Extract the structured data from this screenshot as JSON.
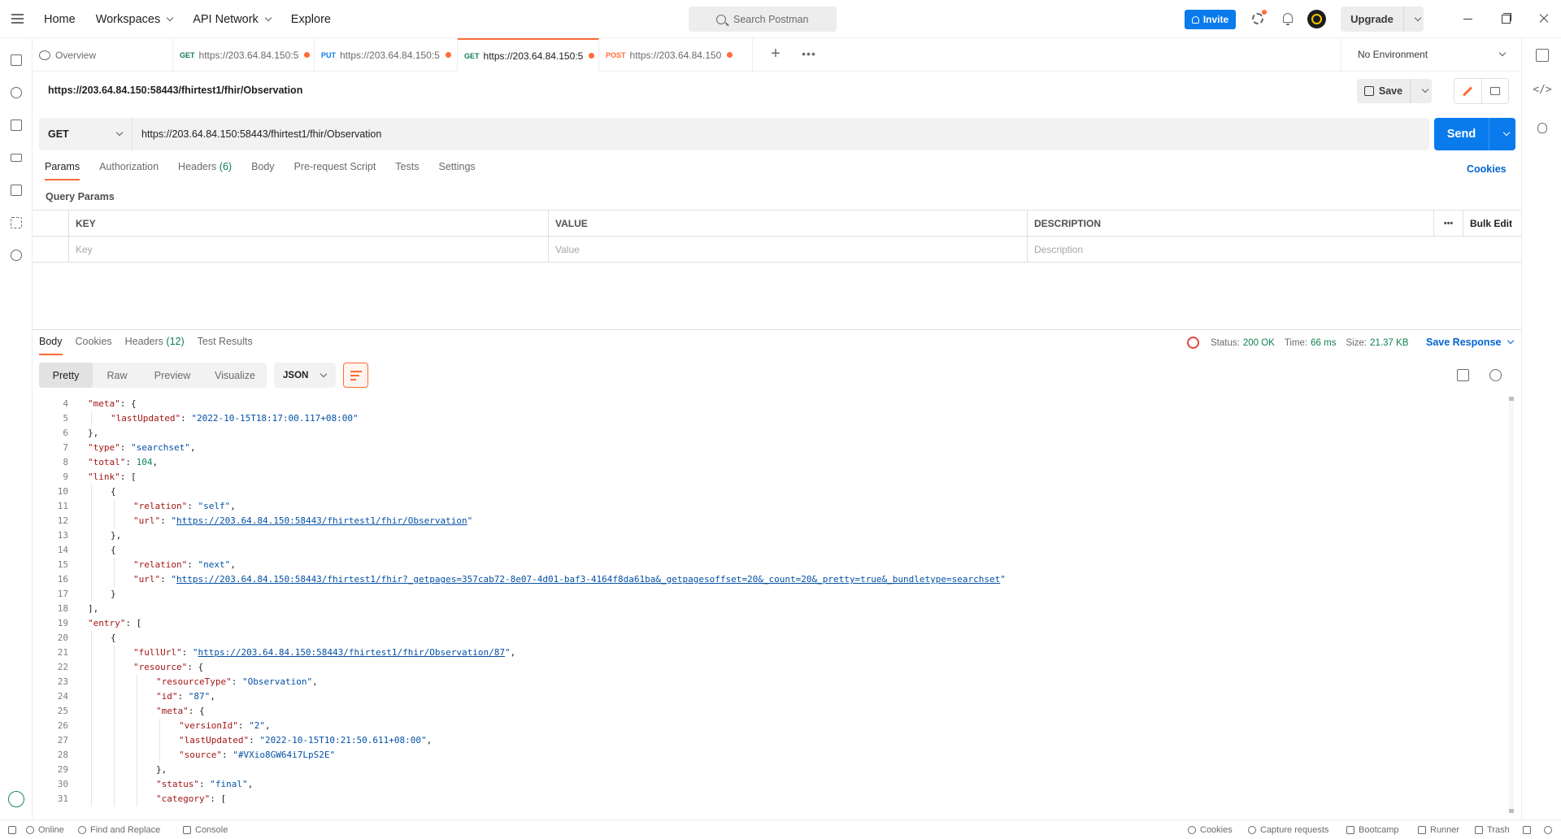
{
  "nav": {
    "home": "Home",
    "workspaces": "Workspaces",
    "api_network": "API Network",
    "explore": "Explore",
    "search_placeholder": "Search Postman",
    "invite": "Invite",
    "upgrade": "Upgrade"
  },
  "tabs": [
    {
      "method": "",
      "label": "Overview",
      "unsaved": false
    },
    {
      "method": "GET",
      "label": "https://203.64.84.150:5",
      "unsaved": true,
      "method_color": "#0c7f4e"
    },
    {
      "method": "PUT",
      "label": "https://203.64.84.150:5",
      "unsaved": true,
      "method_color": "#097bed"
    },
    {
      "method": "GET",
      "label": "https://203.64.84.150:5",
      "unsaved": true,
      "method_color": "#0c7f4e",
      "active": true
    },
    {
      "method": "POST",
      "label": "https://203.64.84.150",
      "unsaved": true,
      "method_color": "#ff6c37"
    }
  ],
  "environment": "No Environment",
  "request": {
    "title": "https://203.64.84.150:58443/fhirtest1/fhir/Observation",
    "save_label": "Save",
    "method": "GET",
    "url": "https://203.64.84.150:58443/fhirtest1/fhir/Observation",
    "send_label": "Send",
    "subtabs": [
      {
        "label": "Params",
        "count": "",
        "active": true
      },
      {
        "label": "Authorization",
        "count": ""
      },
      {
        "label": "Headers",
        "count": "(6)"
      },
      {
        "label": "Body",
        "count": ""
      },
      {
        "label": "Pre-request Script",
        "count": ""
      },
      {
        "label": "Tests",
        "count": ""
      },
      {
        "label": "Settings",
        "count": ""
      }
    ],
    "cookies_link": "Cookies",
    "query_params_title": "Query Params",
    "params_table": {
      "headers": {
        "key": "KEY",
        "value": "VALUE",
        "description": "DESCRIPTION",
        "more": "•••",
        "bulk_edit": "Bulk Edit"
      },
      "placeholders": {
        "key": "Key",
        "value": "Value",
        "description": "Description"
      }
    }
  },
  "response": {
    "tabs": [
      {
        "label": "Body",
        "count": "",
        "active": true
      },
      {
        "label": "Cookies",
        "count": ""
      },
      {
        "label": "Headers",
        "count": "(12)"
      },
      {
        "label": "Test Results",
        "count": ""
      }
    ],
    "status_label": "Status:",
    "status_value": "200 OK",
    "time_label": "Time:",
    "time_value": "66 ms",
    "size_label": "Size:",
    "size_value": "21.37 KB",
    "save_response": "Save Response",
    "views": [
      "Pretty",
      "Raw",
      "Preview",
      "Visualize"
    ],
    "format": "JSON",
    "code_lines": [
      {
        "n": "4",
        "indent": 1,
        "parts": [
          [
            "k",
            "\"meta\""
          ],
          [
            "p",
            ": {"
          ]
        ]
      },
      {
        "n": "5",
        "indent": 2,
        "parts": [
          [
            "k",
            "\"lastUpdated\""
          ],
          [
            "p",
            ": "
          ],
          [
            "s",
            "\"2022-10-15T18:17:00.117+08:00\""
          ]
        ]
      },
      {
        "n": "6",
        "indent": 1,
        "parts": [
          [
            "p",
            "},"
          ]
        ]
      },
      {
        "n": "7",
        "indent": 1,
        "parts": [
          [
            "k",
            "\"type\""
          ],
          [
            "p",
            ": "
          ],
          [
            "s",
            "\"searchset\""
          ],
          [
            "p",
            ","
          ]
        ]
      },
      {
        "n": "8",
        "indent": 1,
        "parts": [
          [
            "k",
            "\"total\""
          ],
          [
            "p",
            ": "
          ],
          [
            "nm",
            "104"
          ],
          [
            "p",
            ","
          ]
        ]
      },
      {
        "n": "9",
        "indent": 1,
        "parts": [
          [
            "k",
            "\"link\""
          ],
          [
            "p",
            ": ["
          ]
        ]
      },
      {
        "n": "10",
        "indent": 2,
        "parts": [
          [
            "p",
            "{"
          ]
        ]
      },
      {
        "n": "11",
        "indent": 3,
        "parts": [
          [
            "k",
            "\"relation\""
          ],
          [
            "p",
            ": "
          ],
          [
            "s",
            "\"self\""
          ],
          [
            "p",
            ","
          ]
        ]
      },
      {
        "n": "12",
        "indent": 3,
        "parts": [
          [
            "k",
            "\"url\""
          ],
          [
            "p",
            ": "
          ],
          [
            "s",
            "\""
          ],
          [
            "u",
            "https://203.64.84.150:58443/fhirtest1/fhir/Observation"
          ],
          [
            "s",
            "\""
          ]
        ]
      },
      {
        "n": "13",
        "indent": 2,
        "parts": [
          [
            "p",
            "},"
          ]
        ]
      },
      {
        "n": "14",
        "indent": 2,
        "parts": [
          [
            "p",
            "{"
          ]
        ]
      },
      {
        "n": "15",
        "indent": 3,
        "parts": [
          [
            "k",
            "\"relation\""
          ],
          [
            "p",
            ": "
          ],
          [
            "s",
            "\"next\""
          ],
          [
            "p",
            ","
          ]
        ]
      },
      {
        "n": "16",
        "indent": 3,
        "parts": [
          [
            "k",
            "\"url\""
          ],
          [
            "p",
            ": "
          ],
          [
            "s",
            "\""
          ],
          [
            "u",
            "https://203.64.84.150:58443/fhirtest1/fhir?_getpages=357cab72-8e07-4d01-baf3-4164f8da61ba&_getpagesoffset=20&_count=20&_pretty=true&_bundletype=searchset"
          ],
          [
            "s",
            "\""
          ]
        ]
      },
      {
        "n": "17",
        "indent": 2,
        "parts": [
          [
            "p",
            "}"
          ]
        ]
      },
      {
        "n": "18",
        "indent": 1,
        "parts": [
          [
            "p",
            "],"
          ]
        ]
      },
      {
        "n": "19",
        "indent": 1,
        "parts": [
          [
            "k",
            "\"entry\""
          ],
          [
            "p",
            ": ["
          ]
        ]
      },
      {
        "n": "20",
        "indent": 2,
        "parts": [
          [
            "p",
            "{"
          ]
        ]
      },
      {
        "n": "21",
        "indent": 3,
        "parts": [
          [
            "k",
            "\"fullUrl\""
          ],
          [
            "p",
            ": "
          ],
          [
            "s",
            "\""
          ],
          [
            "u",
            "https://203.64.84.150:58443/fhirtest1/fhir/Observation/87"
          ],
          [
            "s",
            "\""
          ],
          [
            "p",
            ","
          ]
        ]
      },
      {
        "n": "22",
        "indent": 3,
        "parts": [
          [
            "k",
            "\"resource\""
          ],
          [
            "p",
            ": {"
          ]
        ]
      },
      {
        "n": "23",
        "indent": 4,
        "parts": [
          [
            "k",
            "\"resourceType\""
          ],
          [
            "p",
            ": "
          ],
          [
            "s",
            "\"Observation\""
          ],
          [
            "p",
            ","
          ]
        ]
      },
      {
        "n": "24",
        "indent": 4,
        "parts": [
          [
            "k",
            "\"id\""
          ],
          [
            "p",
            ": "
          ],
          [
            "s",
            "\"87\""
          ],
          [
            "p",
            ","
          ]
        ]
      },
      {
        "n": "25",
        "indent": 4,
        "parts": [
          [
            "k",
            "\"meta\""
          ],
          [
            "p",
            ": {"
          ]
        ]
      },
      {
        "n": "26",
        "indent": 5,
        "parts": [
          [
            "k",
            "\"versionId\""
          ],
          [
            "p",
            ": "
          ],
          [
            "s",
            "\"2\""
          ],
          [
            "p",
            ","
          ]
        ]
      },
      {
        "n": "27",
        "indent": 5,
        "parts": [
          [
            "k",
            "\"lastUpdated\""
          ],
          [
            "p",
            ": "
          ],
          [
            "s",
            "\"2022-10-15T10:21:50.611+08:00\""
          ],
          [
            "p",
            ","
          ]
        ]
      },
      {
        "n": "28",
        "indent": 5,
        "parts": [
          [
            "k",
            "\"source\""
          ],
          [
            "p",
            ": "
          ],
          [
            "s",
            "\"#VXio8GW64i7LpS2E\""
          ]
        ]
      },
      {
        "n": "29",
        "indent": 4,
        "parts": [
          [
            "p",
            "},"
          ]
        ]
      },
      {
        "n": "30",
        "indent": 4,
        "parts": [
          [
            "k",
            "\"status\""
          ],
          [
            "p",
            ": "
          ],
          [
            "s",
            "\"final\""
          ],
          [
            "p",
            ","
          ]
        ]
      },
      {
        "n": "31",
        "indent": 4,
        "parts": [
          [
            "k",
            "\"category\""
          ],
          [
            "p",
            ": ["
          ]
        ]
      }
    ]
  },
  "statusbar": {
    "online": "Online",
    "find_replace": "Find and Replace",
    "console": "Console",
    "cookies": "Cookies",
    "capture": "Capture requests",
    "bootcamp": "Bootcamp",
    "runner": "Runner",
    "trash": "Trash"
  }
}
